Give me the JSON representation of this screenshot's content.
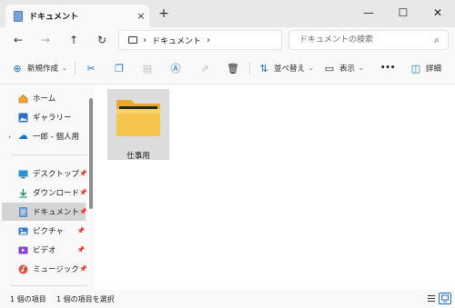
{
  "tab": {
    "title": "ドキュメント",
    "close": "×",
    "new_tab": "+"
  },
  "window_controls": {
    "minimize": "—",
    "maximize": "☐",
    "close": "✕"
  },
  "nav": {
    "back": "←",
    "forward": "→",
    "up": "↑",
    "refresh": "↻"
  },
  "address": {
    "separator": "›",
    "crumb": "ドキュメント",
    "trail_separator": "›"
  },
  "search": {
    "placeholder": "ドキュメントの検索",
    "icon": "⌕"
  },
  "commands": {
    "new": "新規作成",
    "sort": "並べ替え",
    "view": "表示",
    "more": "•••",
    "details": "詳細"
  },
  "sidebar": {
    "quick": [
      {
        "label": "ホーム",
        "icon": "home-icon"
      },
      {
        "label": "ギャラリー",
        "icon": "gallery-icon"
      },
      {
        "label": "一郎 - 個人用",
        "icon": "onedrive-icon"
      }
    ],
    "pinned": [
      {
        "label": "デスクトップ",
        "icon": "desktop-icon"
      },
      {
        "label": "ダウンロード",
        "icon": "download-icon"
      },
      {
        "label": "ドキュメント",
        "icon": "documents-icon",
        "selected": true
      },
      {
        "label": "ピクチャ",
        "icon": "pictures-icon"
      },
      {
        "label": "ビデオ",
        "icon": "videos-icon"
      },
      {
        "label": "ミュージック",
        "icon": "music-icon"
      }
    ],
    "pin_glyph": "📌"
  },
  "content": {
    "items": [
      {
        "name": "仕事用",
        "type": "folder"
      }
    ]
  },
  "status": {
    "item_count": "1 個の項目",
    "selected_count": "1 個の項目を選択"
  },
  "colors": {
    "accent": "#1a73c8",
    "folder": "#f6c54e",
    "selected_bg": "#d4d4d4"
  }
}
